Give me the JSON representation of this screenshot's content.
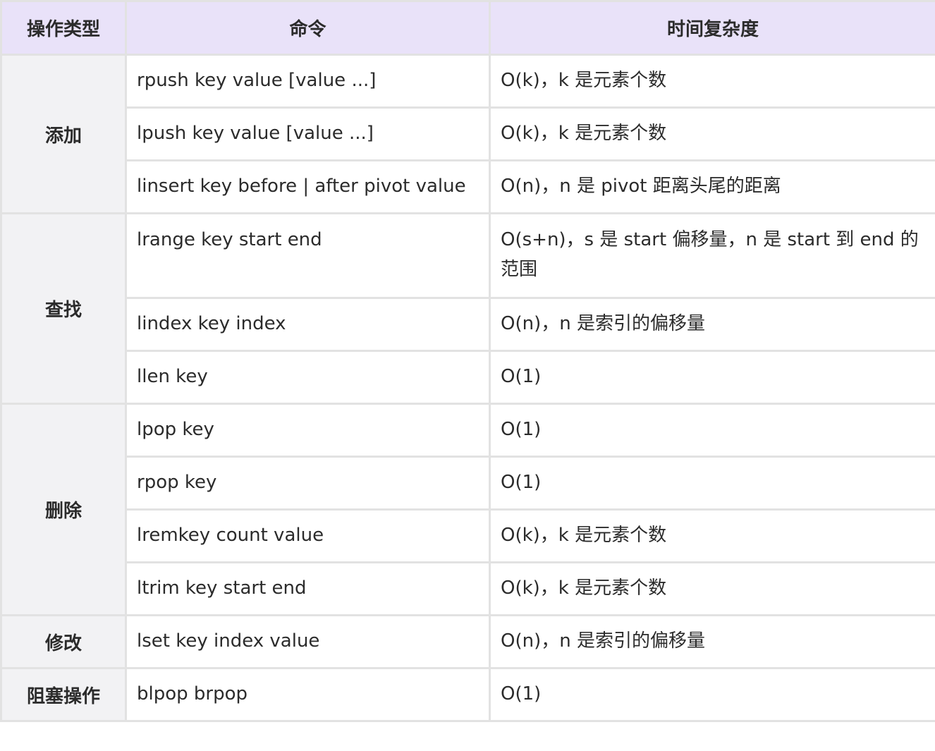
{
  "headers": {
    "type": "操作类型",
    "command": "命令",
    "complexity": "时间复杂度"
  },
  "groups": [
    {
      "category": "添加",
      "rows": [
        {
          "command": "rpush key value [value ...]",
          "complexity": "O(k)，k 是元素个数"
        },
        {
          "command": "lpush key value [value ...]",
          "complexity": "O(k)，k 是元素个数"
        },
        {
          "command": "linsert key before | after pivot value",
          "complexity": "O(n)，n 是 pivot 距离头尾的距离"
        }
      ]
    },
    {
      "category": "查找",
      "rows": [
        {
          "command": "lrange key start end",
          "complexity": "O(s+n)，s 是 start 偏移量，n 是 start 到 end 的范围"
        },
        {
          "command": "lindex key index",
          "complexity": "O(n)，n 是索引的偏移量"
        },
        {
          "command": "llen key",
          "complexity": "O(1)"
        }
      ]
    },
    {
      "category": "删除",
      "rows": [
        {
          "command": "lpop key",
          "complexity": "O(1)"
        },
        {
          "command": "rpop key",
          "complexity": "O(1)"
        },
        {
          "command": "lremkey count value",
          "complexity": "O(k)，k 是元素个数"
        },
        {
          "command": "ltrim key start end",
          "complexity": "O(k)，k 是元素个数"
        }
      ]
    },
    {
      "category": "修改",
      "rows": [
        {
          "command": "lset key index value",
          "complexity": "O(n)，n 是索引的偏移量"
        }
      ]
    },
    {
      "category": "阻塞操作",
      "rows": [
        {
          "command": "blpop brpop",
          "complexity": "O(1)"
        }
      ]
    }
  ]
}
